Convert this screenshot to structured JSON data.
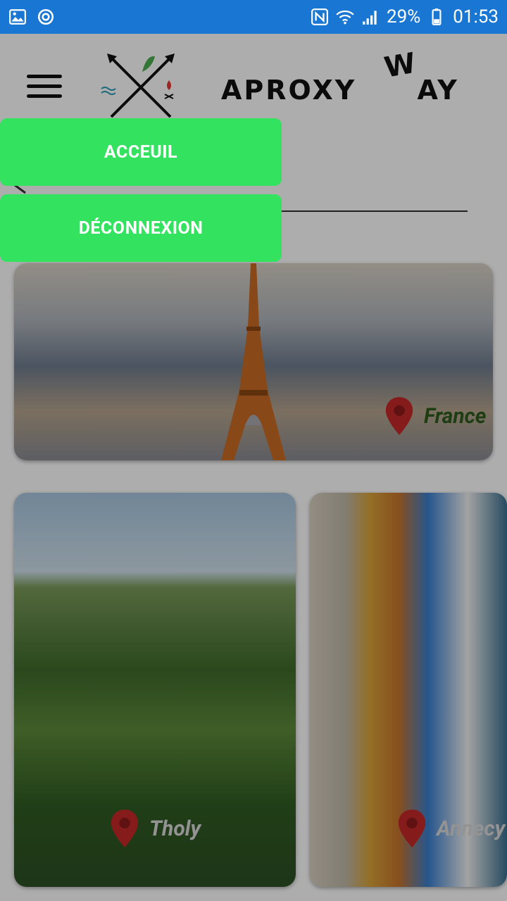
{
  "status_bar": {
    "battery": "29%",
    "time": "01:53",
    "icons": [
      "image-icon",
      "sync-icon",
      "nfc-icon",
      "wifi-icon",
      "signal-icon",
      "battery-icon"
    ]
  },
  "header": {
    "brand_main": "APROXY",
    "brand_w": "W",
    "brand_tail": "AY"
  },
  "drawer": {
    "items": [
      {
        "label": "ACCEUIL"
      },
      {
        "label": "DÉCONNEXION"
      }
    ]
  },
  "cards": [
    {
      "place": "France",
      "label_color": "#2e5a1b"
    },
    {
      "place": "Tholy",
      "label_color": "#d9d9d9"
    },
    {
      "place": "Annecy",
      "label_color": "#d9d9d9"
    }
  ],
  "colors": {
    "status_bar": "#1976d2",
    "drawer_button": "#33e35f",
    "pin": "#c62828"
  }
}
